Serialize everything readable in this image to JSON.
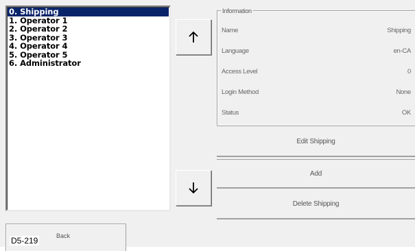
{
  "users": {
    "items": [
      {
        "label": "0. Shipping",
        "selected": true
      },
      {
        "label": "1. Operator 1",
        "selected": false
      },
      {
        "label": "2. Operator 2",
        "selected": false
      },
      {
        "label": "3. Operator 3",
        "selected": false
      },
      {
        "label": "4. Operator 4",
        "selected": false
      },
      {
        "label": "5. Operator 5",
        "selected": false
      },
      {
        "label": "6. Administrator",
        "selected": false
      }
    ]
  },
  "nav": {
    "up_icon": "arrow-up-icon",
    "down_icon": "arrow-down-icon"
  },
  "info": {
    "legend": "Information",
    "rows": [
      {
        "label": "Name",
        "value": "Shipping"
      },
      {
        "label": "Language",
        "value": "en-CA"
      },
      {
        "label": "Access Level",
        "value": "0"
      },
      {
        "label": "Login Method",
        "value": "None"
      },
      {
        "label": "Status",
        "value": "OK"
      }
    ]
  },
  "actions": {
    "edit_label": "Edit Shipping",
    "add_label": "Add",
    "delete_label": "Delete Shipping"
  },
  "footer": {
    "back_label": "Back",
    "figure_code": "D5-219"
  },
  "colors": {
    "selection": "#0a246a",
    "panel": "#f0f0f0"
  }
}
